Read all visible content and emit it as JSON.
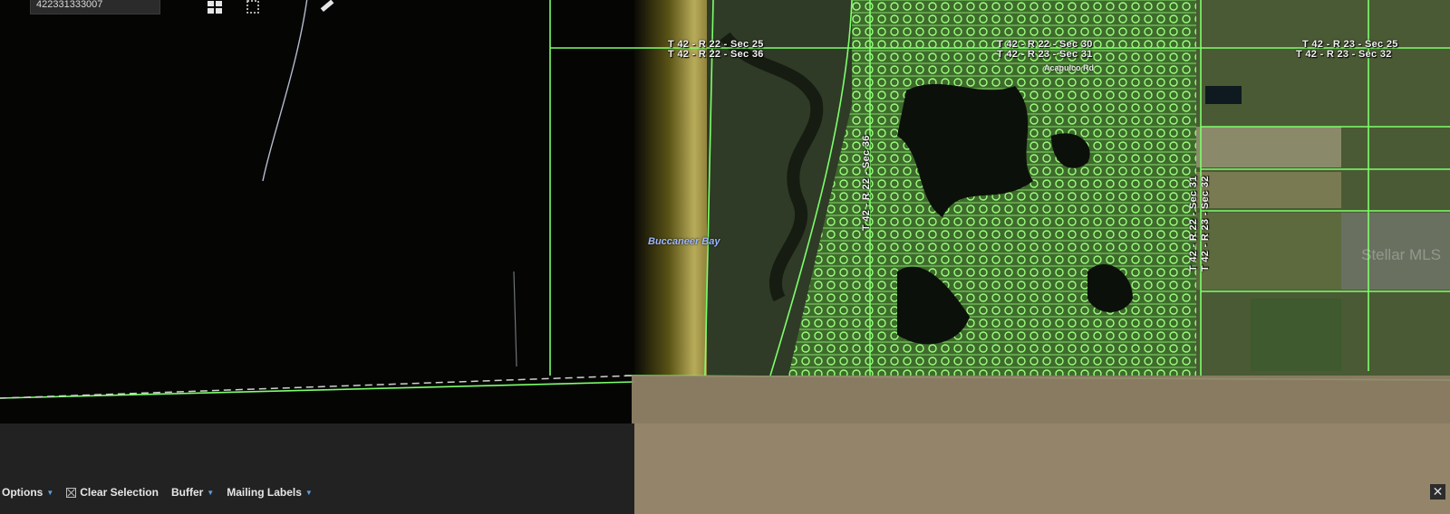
{
  "search": {
    "parcel_value": "422331333007"
  },
  "map": {
    "section_labels": {
      "t42_r22_sec25": "T 42 - R 22 - Sec 25",
      "t42_r22_sec36": "T 42 - R 22 - Sec 36",
      "t42_r22_sec30": "T 42 - R 22 - Sec 30",
      "t42_r23_sec31_top": "T 42 - R 23 - Sec 31",
      "t42_r23_sec25": "T 42 - R 23 - Sec 25",
      "t42_r23_sec32": "T 42 - R 23 - Sec 32",
      "vertical_sec31": "T 42 - R 22 - Sec 31",
      "vertical_sec32": "T 42 - R 23 - Sec 32",
      "vertical_sec36": "T 42 - R 22 - Sec 36"
    },
    "place_label": "Buccaneer Bay",
    "road_label": "Acapulco Rd",
    "watermark": "Stellar MLS",
    "colors": {
      "parcel_line": "#7dff6b",
      "water": "#050604",
      "overlay_tan": "#94856a"
    }
  },
  "toolbar": {
    "options_label": "Options",
    "clear_selection_label": "Clear Selection",
    "buffer_label": "Buffer",
    "mailing_labels_label": "Mailing Labels",
    "close_symbol": "✕"
  }
}
